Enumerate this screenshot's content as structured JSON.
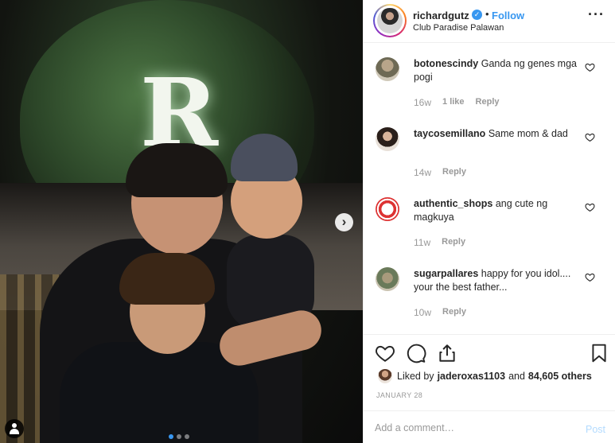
{
  "post": {
    "carousel_next": "›",
    "pagination": [
      "active",
      "inactive",
      "inactive"
    ]
  },
  "header": {
    "username": "richardgutz",
    "verified_mark": "✓",
    "separator": "•",
    "follow_label": "Follow",
    "location": "Club Paradise Palawan",
    "more": "···"
  },
  "comments": [
    {
      "user": "botonescindy",
      "text": "Ganda ng genes mga pogi",
      "time": "16w",
      "likes": "1 like",
      "reply": "Reply"
    },
    {
      "user": "taycosemillano",
      "text": "Same mom & dad",
      "time": "14w",
      "likes": "",
      "reply": "Reply"
    },
    {
      "user": "authentic_shops",
      "text": "ang cute ng magkuya",
      "time": "11w",
      "likes": "",
      "reply": "Reply"
    },
    {
      "user": "sugarpallares",
      "text": "happy for you idol.... your the best father...",
      "time": "10w",
      "likes": "",
      "reply": "Reply"
    }
  ],
  "likes": {
    "prefix": "Liked by",
    "user": "jaderoxas1103",
    "middle": "and",
    "count": "84,605 others"
  },
  "date": "JANUARY 28",
  "add_comment": {
    "placeholder": "Add a comment…",
    "post_label": "Post"
  },
  "icons": {
    "heart": "heart-icon",
    "comment": "comment-icon",
    "share": "share-icon",
    "bookmark": "bookmark-icon",
    "user_tag": "user-tag-icon"
  },
  "colors": {
    "accent": "#3897f0",
    "muted": "#999999",
    "post_disabled": "#b3dbff"
  }
}
